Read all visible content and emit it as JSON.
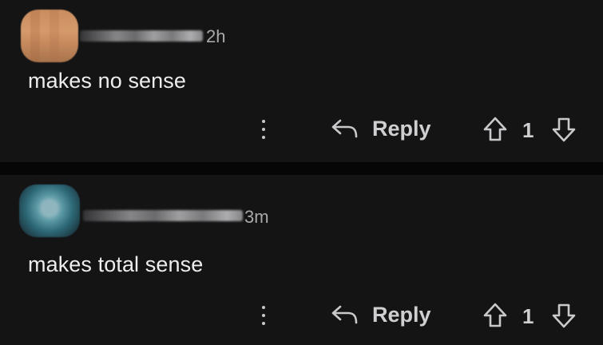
{
  "comments": [
    {
      "time": "2h",
      "text": "makes no sense",
      "reply_label": "Reply",
      "votes": "1"
    },
    {
      "time": "3m",
      "text": "makes total sense",
      "reply_label": "Reply",
      "votes": "1"
    }
  ],
  "colors": {
    "background": "#141415",
    "divider": "#060607",
    "text": "#ededee",
    "muted": "#a9a9ab"
  },
  "icons": {
    "more": "vertical-ellipsis-icon",
    "reply": "reply-arrow-icon",
    "upvote": "upvote-arrow-icon",
    "downvote": "downvote-arrow-icon"
  }
}
